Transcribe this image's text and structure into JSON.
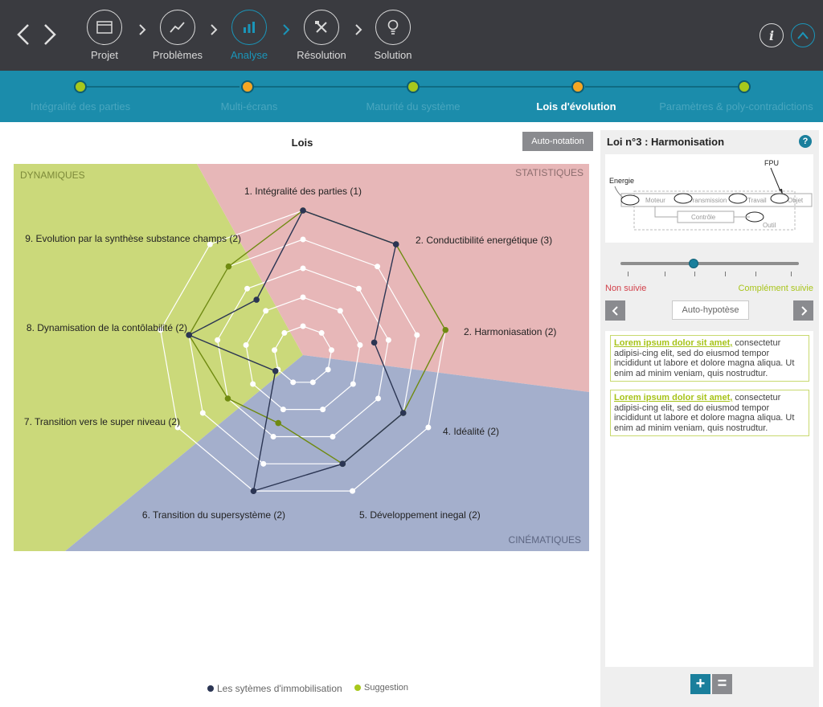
{
  "top_nav": {
    "steps": [
      {
        "label": "Projet",
        "icon": "window-icon"
      },
      {
        "label": "Problèmes",
        "icon": "trend-icon"
      },
      {
        "label": "Analyse",
        "icon": "bar-chart-icon"
      },
      {
        "label": "Résolution",
        "icon": "tools-icon"
      },
      {
        "label": "Solution",
        "icon": "lightbulb-icon"
      }
    ],
    "active_step": "Analyse",
    "info_label": "i"
  },
  "timeline": {
    "items": [
      {
        "label": "Intégralité des parties",
        "color": "#a8c81c"
      },
      {
        "label": "Multi-écrans",
        "color": "#f5a623"
      },
      {
        "label": "Maturité du système",
        "color": "#a8c81c"
      },
      {
        "label": "Lois d'évolution",
        "color": "#f5a623"
      },
      {
        "label": "Paramètres & poly-contradictions",
        "color": "#a8c81c"
      }
    ],
    "active": "Lois d'évolution"
  },
  "main": {
    "title": "Lois",
    "auto_notation_label": "Auto-notation"
  },
  "chart_data": {
    "type": "radar",
    "title": "Lois",
    "axes": [
      "1. Intégralité des parties (1)",
      "2. Conductibilité energétique (3)",
      "2. Harmoniasation (2)",
      "4. Idéalité (2)",
      "5. Développement inegal (2)",
      "6. Transition du supersystème (2)",
      "7. Transition vers le super niveau (2)",
      "8. Dynamisation de la contôlabilité (2)",
      "9. Evolution par la synthèse substance champs (2)"
    ],
    "rmax": 5,
    "rings": 5,
    "zones": [
      {
        "label": "DYNAMIQUES",
        "color": "#cbd97a"
      },
      {
        "label": "STATISTIQUES",
        "color": "#e7b7b8"
      },
      {
        "label": "CINÉMATIQUES",
        "color": "#a4afcc"
      }
    ],
    "series": [
      {
        "name": "Les sytèmes d'immobilisation",
        "color": "#2b3553",
        "values": [
          5,
          5,
          2.5,
          4,
          4,
          5,
          1.1,
          4,
          2.5
        ]
      },
      {
        "name": "Suggestion",
        "color": "#6f8a10",
        "values": [
          5,
          5,
          5,
          4,
          4,
          2.5,
          3,
          4,
          4
        ]
      }
    ]
  },
  "side_panel": {
    "title": "Loi n°3 : Harmonisation",
    "help_label": "?",
    "diagram": {
      "fpu": "FPU",
      "energie": "Energie",
      "moteur": "Moteur",
      "transmission": "Transmission",
      "travail": "Travail",
      "objet": "Objet",
      "controle": "Contrôle",
      "outil": "Outil"
    },
    "slider": {
      "value": 0.41
    },
    "label_left": "Non suivie",
    "label_right": "Complément suivie",
    "auto_hypothese_label": "Auto-hypotèse",
    "notes": [
      {
        "highlight": "Lorem ipsum dolor sit amet,",
        "text": " consectetur adipisi-cing elit, sed do eiusmod tempor incididunt ut labore et dolore magna aliqua. Ut enim ad minim veniam, quis nostrudtur."
      },
      {
        "highlight": "Lorem ipsum dolor sit amet,",
        "text": " consectetur adipisi-cing elit, sed do eiusmod tempor incididunt ut labore et dolore magna aliqua. Ut enim ad minim veniam, quis nostrudtur."
      }
    ],
    "plus_label": "+",
    "equal_label": "=",
    "colors": {
      "plus": "#1a7f9c",
      "equal": "#8a8b8f"
    }
  },
  "legend": {
    "items": [
      {
        "label": "Les sytèmes d'immobilisation",
        "color": "#2b3553"
      },
      {
        "label": "Suggestion",
        "color": "#a8c81c"
      }
    ]
  }
}
